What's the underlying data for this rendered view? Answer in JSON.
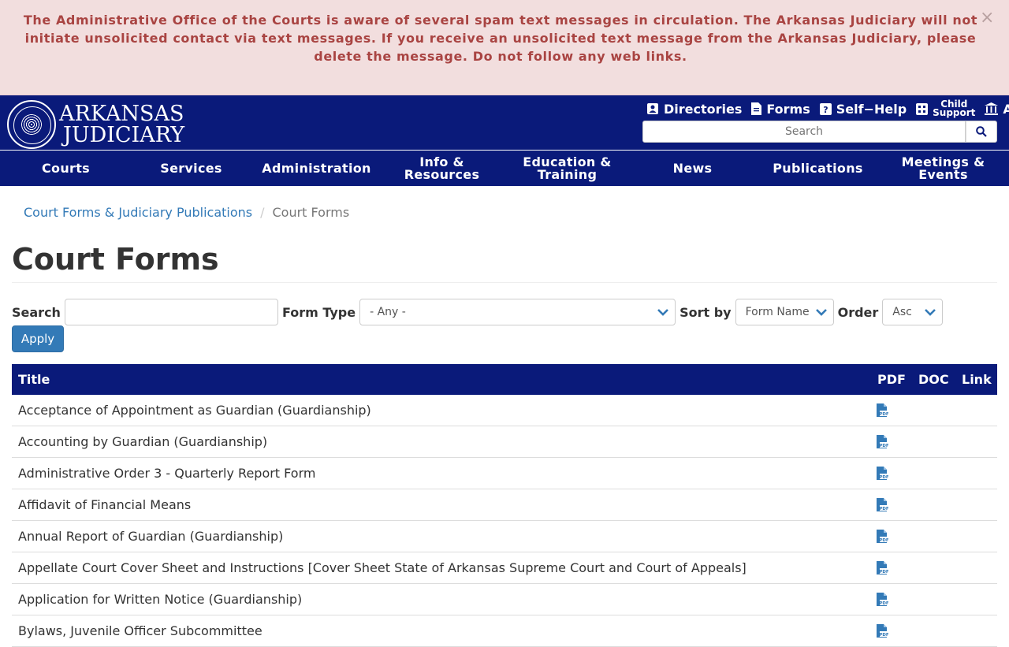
{
  "alert": {
    "message": "The Administrative Office of the Courts is aware of several spam text messages in circulation.  The Arkansas Judiciary will not initiate unsolicited contact via text messages. If you receive an unsolicited text message from the Arkansas Judiciary, please delete the message. Do not follow any web links.",
    "close": "×"
  },
  "header": {
    "logo_line1": "ARKANSAS",
    "logo_line2": "JUDICIARY",
    "utility": {
      "directories": "Directories",
      "forms": "Forms",
      "self_help": "Self−Help",
      "child_support_1": "Child",
      "child_support_2": "Support",
      "extra": "A"
    },
    "search_placeholder": "Search"
  },
  "nav": {
    "items": [
      {
        "l1": "Courts",
        "l2": ""
      },
      {
        "l1": "Services",
        "l2": ""
      },
      {
        "l1": "Administration",
        "l2": ""
      },
      {
        "l1": "Info &",
        "l2": "Resources"
      },
      {
        "l1": "Education &",
        "l2": "Training"
      },
      {
        "l1": "News",
        "l2": ""
      },
      {
        "l1": "Publications",
        "l2": ""
      },
      {
        "l1": "Meetings &",
        "l2": "Events"
      }
    ]
  },
  "breadcrumb": {
    "parent": "Court Forms & Judiciary Publications",
    "separator": "/",
    "current": "Court Forms"
  },
  "page_title": "Court Forms",
  "filters": {
    "search_label": "Search",
    "search_value": "",
    "form_type_label": "Form Type",
    "form_type_value": "- Any -",
    "sort_label": "Sort by",
    "sort_value": "Form Name",
    "order_label": "Order",
    "order_value": "Asc",
    "apply": "Apply"
  },
  "table": {
    "headers": {
      "title": "Title",
      "pdf": "PDF",
      "doc": "DOC",
      "link": "Link"
    },
    "rows": [
      {
        "title": "Acceptance of Appointment as Guardian (Guardianship)"
      },
      {
        "title": "Accounting by Guardian (Guardianship)"
      },
      {
        "title": "Administrative Order 3 - Quarterly Report Form"
      },
      {
        "title": "Affidavit of Financial Means"
      },
      {
        "title": "Annual Report of Guardian (Guardianship)"
      },
      {
        "title": "Appellate Court Cover Sheet and Instructions [Cover Sheet State of Arkansas Supreme Court and Court of Appeals]"
      },
      {
        "title": "Application for Written Notice (Guardianship)"
      },
      {
        "title": "Bylaws, Juvenile Officer Subcommittee"
      }
    ]
  },
  "colors": {
    "navy": "#0a1a7a",
    "alert_bg": "#f2dede",
    "alert_text": "#a94442",
    "link": "#337ab7"
  }
}
